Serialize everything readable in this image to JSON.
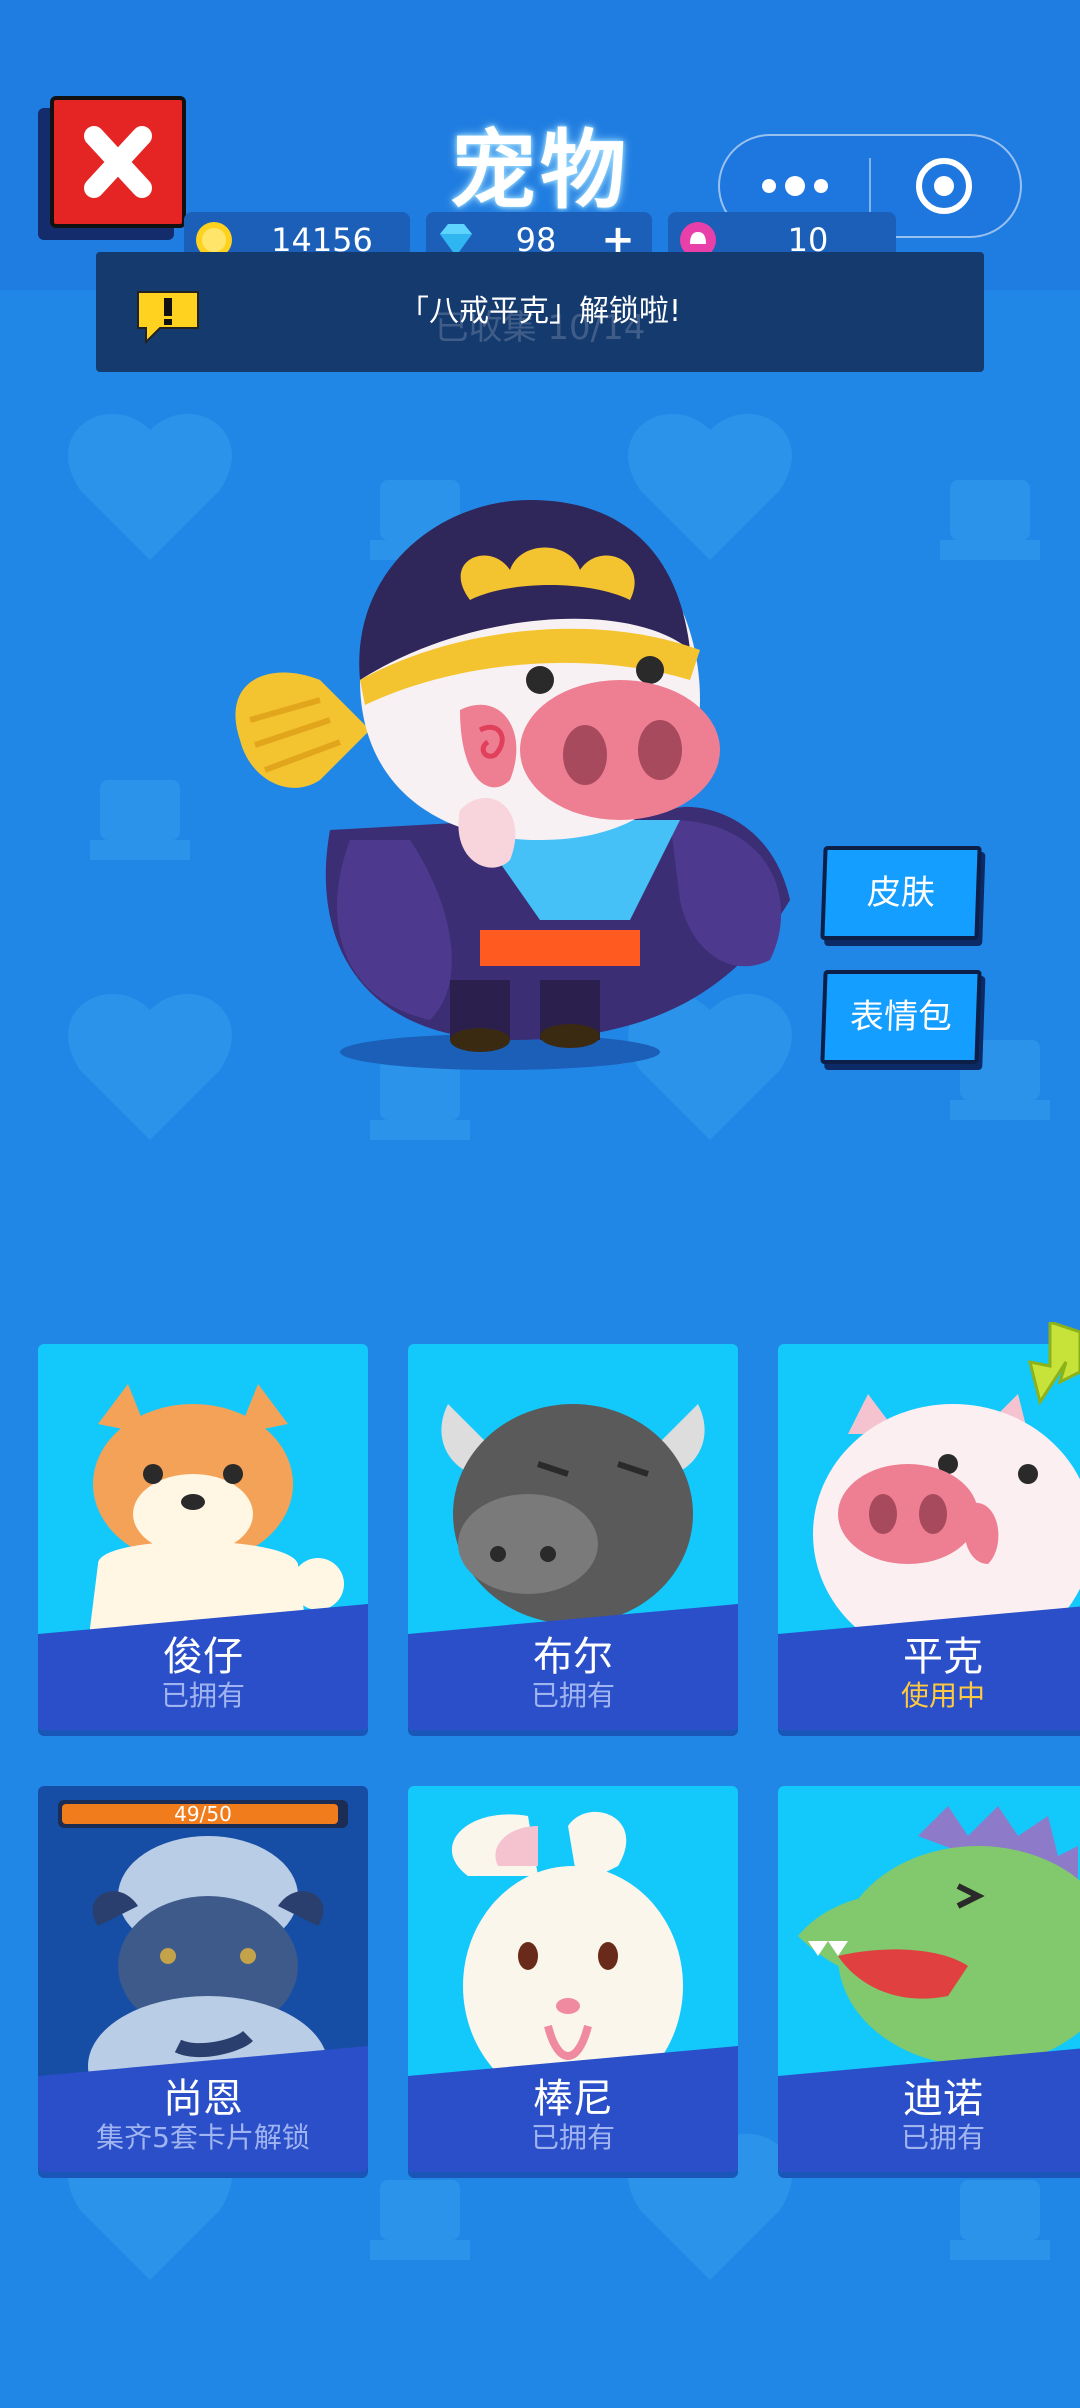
{
  "title": "宠物",
  "currencies": {
    "coins": "14156",
    "gems": "98",
    "gems_add": "+",
    "tokens": "10"
  },
  "collection_text": "已收集 10/14",
  "notification": "「八戒平克」解锁啦!",
  "side_buttons": {
    "skin": "皮肤",
    "emoji": "表情包"
  },
  "pets": [
    {
      "name": "俊仔",
      "status": "已拥有"
    },
    {
      "name": "布尔",
      "status": "已拥有"
    },
    {
      "name": "平克",
      "status": "使用中"
    },
    {
      "name": "尚恩",
      "status": "集齐5套卡片解锁",
      "progress_text": "49/50",
      "progress": 0.98
    },
    {
      "name": "棒尼",
      "status": "已拥有"
    },
    {
      "name": "迪诺",
      "status": "已拥有"
    }
  ],
  "colors": {
    "background": "#2187e6",
    "card": "#13c8fb",
    "card_band": "#2a4fc9",
    "active_status": "#ffc940",
    "close_button": "#e52424"
  }
}
